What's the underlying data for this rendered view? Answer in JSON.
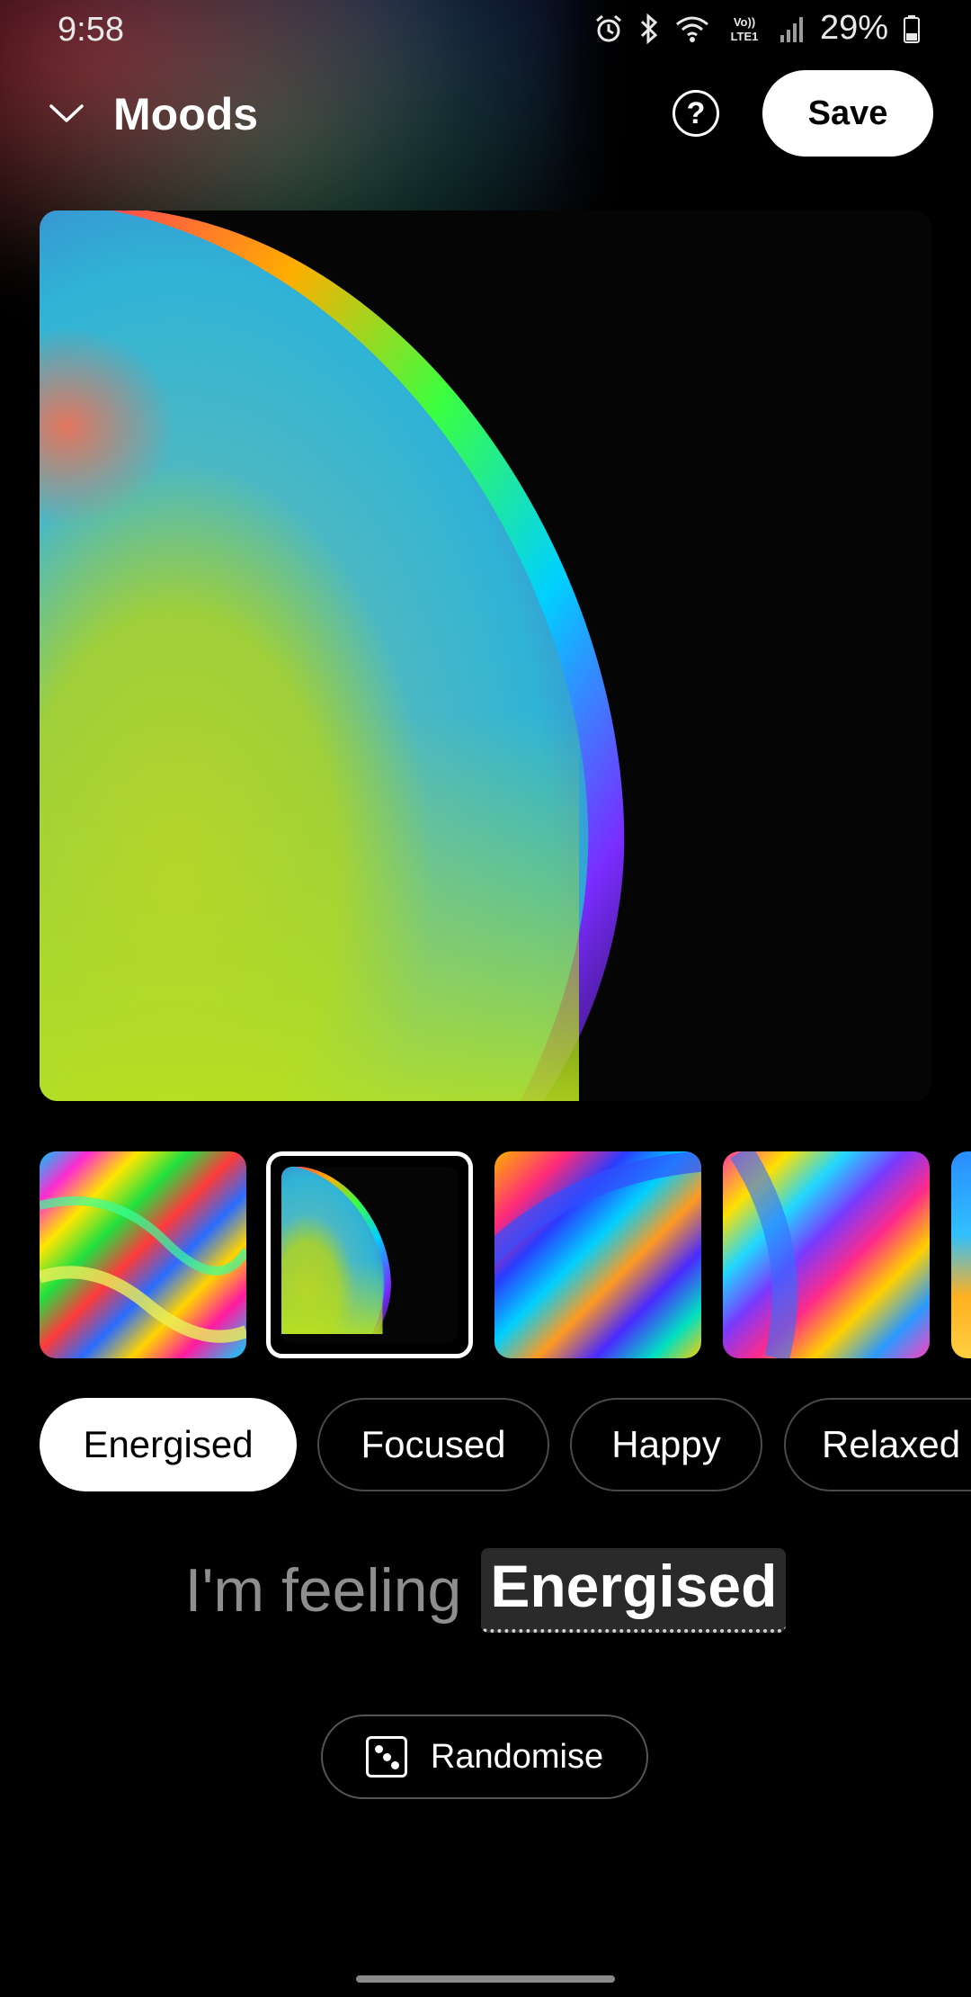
{
  "status_bar": {
    "time": "9:58",
    "battery": "29%",
    "network_label": "LTE1"
  },
  "header": {
    "title": "Moods",
    "help_label": "?",
    "save_label": "Save"
  },
  "thumbnails": {
    "items": [
      "wallpaper-1",
      "wallpaper-2",
      "wallpaper-3",
      "wallpaper-4",
      "wallpaper-5"
    ],
    "selected_index": 1
  },
  "moods": {
    "chips": [
      "Energised",
      "Focused",
      "Happy",
      "Relaxed"
    ],
    "selected": "Energised"
  },
  "feeling": {
    "prefix": "I'm feeling",
    "mood": "Energised"
  },
  "randomise": {
    "label": "Randomise",
    "icon": "dice-icon"
  },
  "colors": {
    "background": "#000000",
    "accent": "#ffffff",
    "muted_text": "#8e8e8e",
    "chip_border": "#4a4a4a"
  }
}
